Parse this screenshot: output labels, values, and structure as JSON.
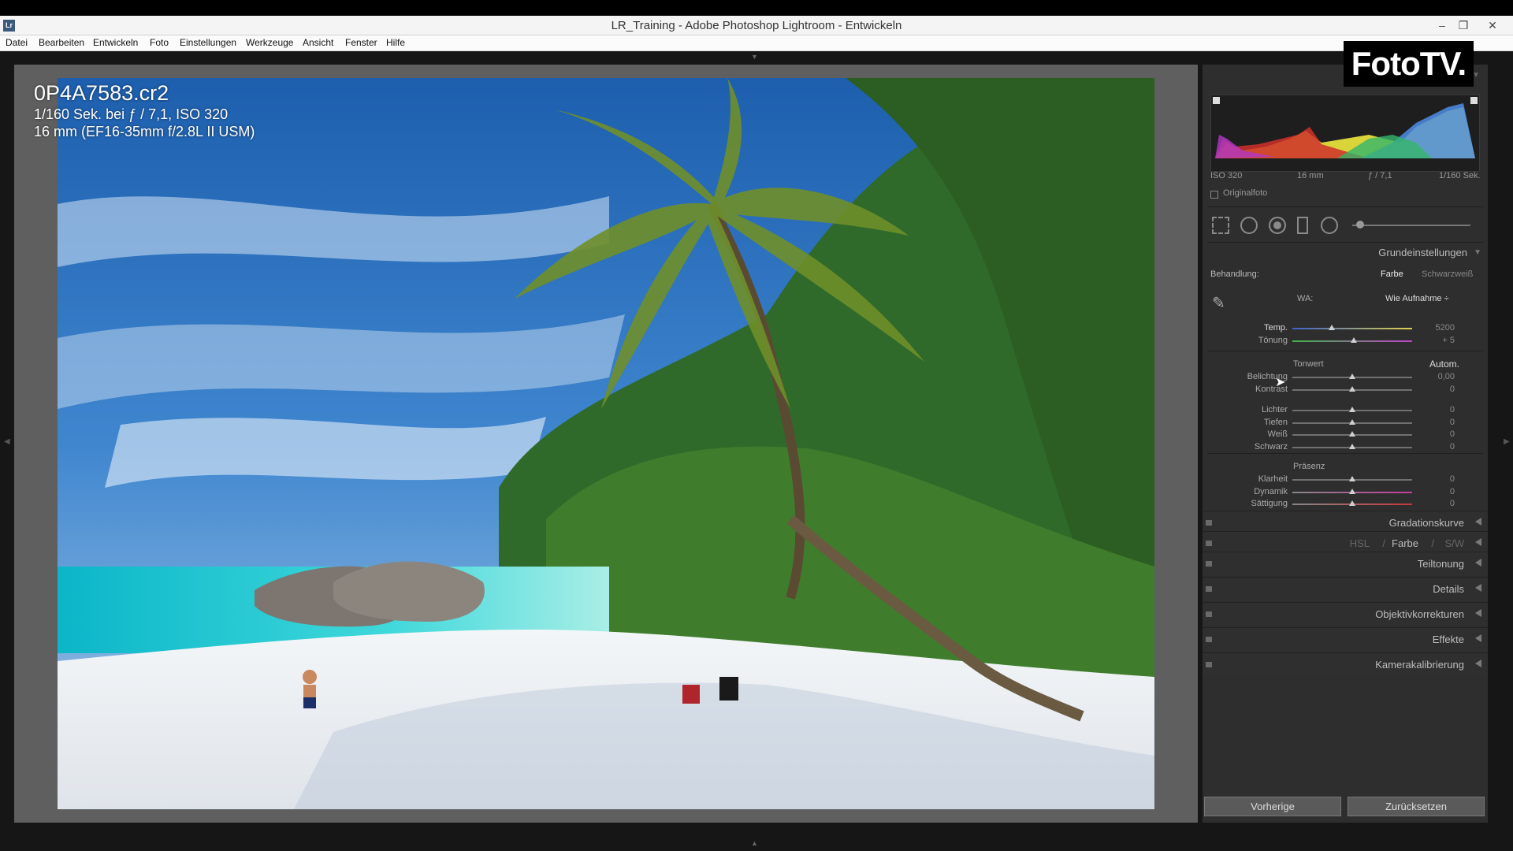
{
  "window": {
    "app_icon": "Lr",
    "title": "LR_Training - Adobe Photoshop Lightroom - Entwickeln",
    "minimize": "–",
    "restore": "❐",
    "close": "✕"
  },
  "menu": [
    "Datei",
    "Bearbeiten",
    "Entwickeln",
    "Foto",
    "Einstellungen",
    "Werkzeuge",
    "Ansicht",
    "Fenster",
    "Hilfe"
  ],
  "watermark": "FotoTV.",
  "photo_info": {
    "file": "0P4A7583.cr2",
    "exposure": "1/160 Sek. bei ƒ / 7,1, ISO 320",
    "lens": "16 mm (EF16-35mm f/2.8L II USM)"
  },
  "histogram": {
    "iso": "ISO 320",
    "focal": "16 mm",
    "aperture": "ƒ / 7,1",
    "shutter": "1/160 Sek.",
    "original_label": "Originalfoto"
  },
  "basic": {
    "title": "Grundeinstellungen",
    "treatment_label": "Behandlung:",
    "color": "Farbe",
    "bw": "Schwarzweiß",
    "wb_label": "WA:",
    "wb_value": "Wie Aufnahme ÷",
    "tone_label": "Tonwert",
    "auto": "Autom.",
    "presence_label": "Präsenz",
    "sliders": [
      {
        "label": "Temp.",
        "value": "5200",
        "pos": 0.33
      },
      {
        "label": "Tönung",
        "value": "+ 5",
        "pos": 0.51
      },
      {
        "label": "Belichtung",
        "value": "0,00",
        "pos": 0.5
      },
      {
        "label": "Kontrast",
        "value": "0",
        "pos": 0.5
      },
      {
        "label": "Lichter",
        "value": "0",
        "pos": 0.5
      },
      {
        "label": "Tiefen",
        "value": "0",
        "pos": 0.5
      },
      {
        "label": "Weiß",
        "value": "0",
        "pos": 0.5
      },
      {
        "label": "Schwarz",
        "value": "0",
        "pos": 0.5
      },
      {
        "label": "Klarheit",
        "value": "0",
        "pos": 0.5
      },
      {
        "label": "Dynamik",
        "value": "0",
        "pos": 0.5
      },
      {
        "label": "Sättigung",
        "value": "0",
        "pos": 0.5
      }
    ]
  },
  "hsl": {
    "hsl": "HSL",
    "sep": "/",
    "color": "Farbe",
    "sep2": "/",
    "sw": "S/W"
  },
  "collapsed_panels": [
    "Gradationskurve",
    "Teiltonung",
    "Details",
    "Objektivkorrekturen",
    "Effekte",
    "Kamerakalibrierung"
  ],
  "buttons": {
    "previous": "Vorherige",
    "reset": "Zurücksetzen"
  }
}
